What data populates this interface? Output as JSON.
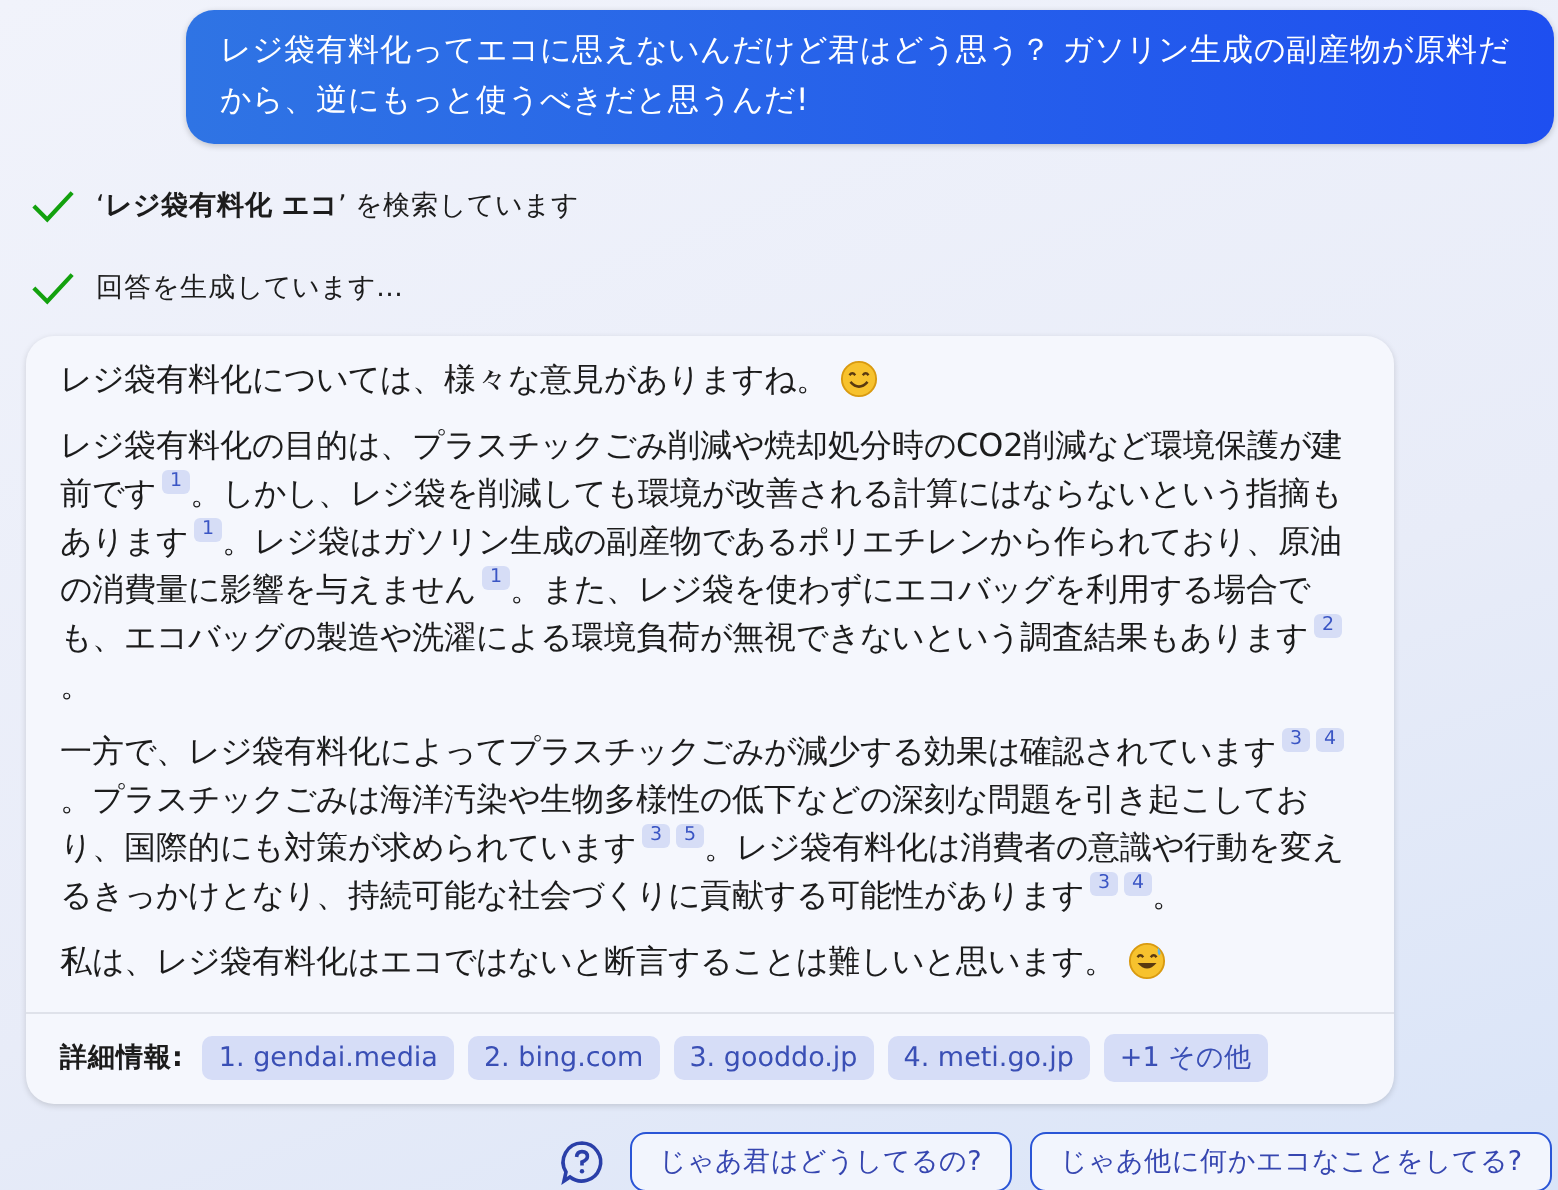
{
  "user_message": "レジ袋有料化ってエコに思えないんだけど君はどう思う？ ガソリン生成の副産物が原料だから、逆にもっと使うべきだと思うんだ!",
  "progress": [
    {
      "text": "‘**レジ袋有料化 エコ**’ を検索しています",
      "done": true
    },
    {
      "text": "回答を生成しています…",
      "done": true
    }
  ],
  "answer": {
    "paragraphs": [
      {
        "emoji": true,
        "segments": [
          {
            "text": "レジ袋有料化については、様々な意見がありますね。"
          }
        ]
      },
      {
        "segments": [
          {
            "text": "レジ袋有料化の目的は、プラスチックごみ削減や焼却処分時のCO2削減など環境保護が建前です",
            "citations": [
              "1"
            ]
          },
          {
            "text": "。しかし、レジ袋を削減しても環境が改善される計算にはならないという指摘もあります",
            "citations": [
              "1"
            ]
          },
          {
            "text": "。レジ袋はガソリン生成の副産物であるポリエチレンから作られており、原油の消費量に影響を与えません",
            "citations": [
              "1"
            ]
          },
          {
            "text": "。また、レジ袋を使わずにエコバッグを利用する場合でも、エコバッグの製造や洗濯による環境負荷が無視できないという調査結果もあります",
            "citations": [
              "2"
            ]
          },
          {
            "text": "。"
          }
        ]
      },
      {
        "segments": [
          {
            "text": "一方で、レジ袋有料化によってプラスチックごみが減少する効果は確認されています",
            "citations": [
              "3",
              "4"
            ]
          },
          {
            "text": "。プラスチックごみは海洋汚染や生物多様性の低下などの深刻な問題を引き起こしており、国際的にも対策が求められています",
            "citations": [
              "3",
              "5"
            ]
          },
          {
            "text": "。レジ袋有料化は消費者の意識や行動を変えるきっかけとなり、持続可能な社会づくりに貢献する可能性があります",
            "citations": [
              "3",
              "4"
            ]
          },
          {
            "text": "。"
          }
        ]
      },
      {
        "emoji": true,
        "segments": [
          {
            "text": "私は、レジ袋有料化はエコではないと断言することは難しいと思います。"
          }
        ]
      }
    ],
    "sources_label": "詳細情報:",
    "sources": [
      "1. gendai.media",
      "2. bing.com",
      "3. gooddo.jp",
      "4. meti.go.jp",
      "+1 その他"
    ]
  },
  "suggestions": [
    "じゃあ君はどうしてるの?",
    "じゃあ他に何かエコなことをしてる?"
  ]
}
